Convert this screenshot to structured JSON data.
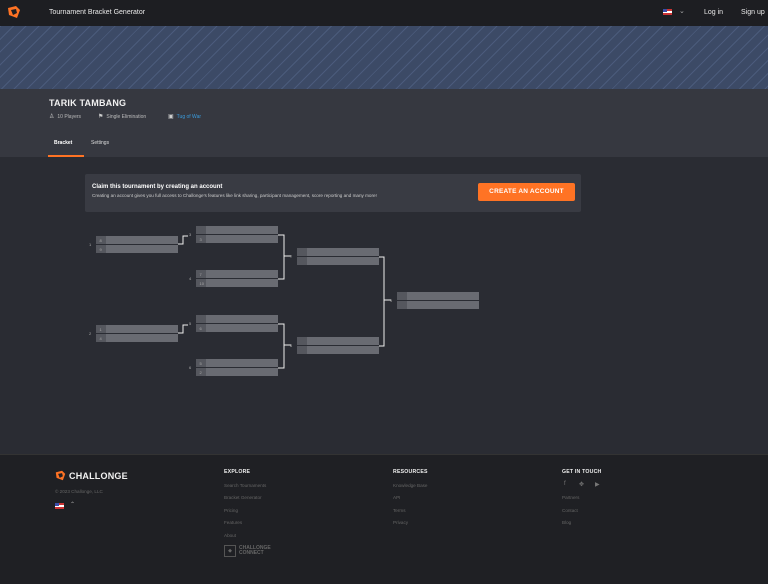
{
  "nav": {
    "title": "Tournament Bracket Generator",
    "login": "Log in",
    "signup": "Sign up"
  },
  "tournament": {
    "name": "TARIK TAMBANG",
    "players": "10 Players",
    "format": "Single Elimination",
    "game": "Tug of War"
  },
  "tabs": [
    "Bracket",
    "Settings"
  ],
  "claim": {
    "title": "Claim this tournament by creating an account",
    "subtitle": "Creating an account gives you full access to Challonge's features like link sharing, participant management, score reporting and many more!",
    "button": "CREATE AN ACCOUNT"
  },
  "bracket": {
    "match_numbers": [
      "1",
      "2",
      "3",
      "4",
      "5",
      "6",
      "7",
      "8",
      "9"
    ],
    "seeds": [
      "8",
      "9",
      "7",
      "10",
      "1",
      "4",
      "5",
      "2",
      "3",
      "6"
    ]
  },
  "footer": {
    "brand": "CHALLONGE",
    "copyright": "© 2023 Challonge, LLC",
    "explore": {
      "heading": "EXPLORE",
      "links": [
        "Search Tournaments",
        "Bracket Generator",
        "Pricing",
        "Features",
        "About"
      ]
    },
    "resources": {
      "heading": "RESOURCES",
      "links": [
        "Knowledge Base",
        "API",
        "Terms",
        "Privacy"
      ]
    },
    "contact": {
      "heading": "GET IN TOUCH",
      "links": [
        "Partners",
        "Contact",
        "Blog"
      ]
    },
    "connect": {
      "line1": "CHALLONGE",
      "line2": "CONNECT"
    }
  },
  "colors": {
    "accent": "#ff7324",
    "link": "#3a9cde",
    "bg": "#2a2c33",
    "nav": "#1d1e22"
  }
}
